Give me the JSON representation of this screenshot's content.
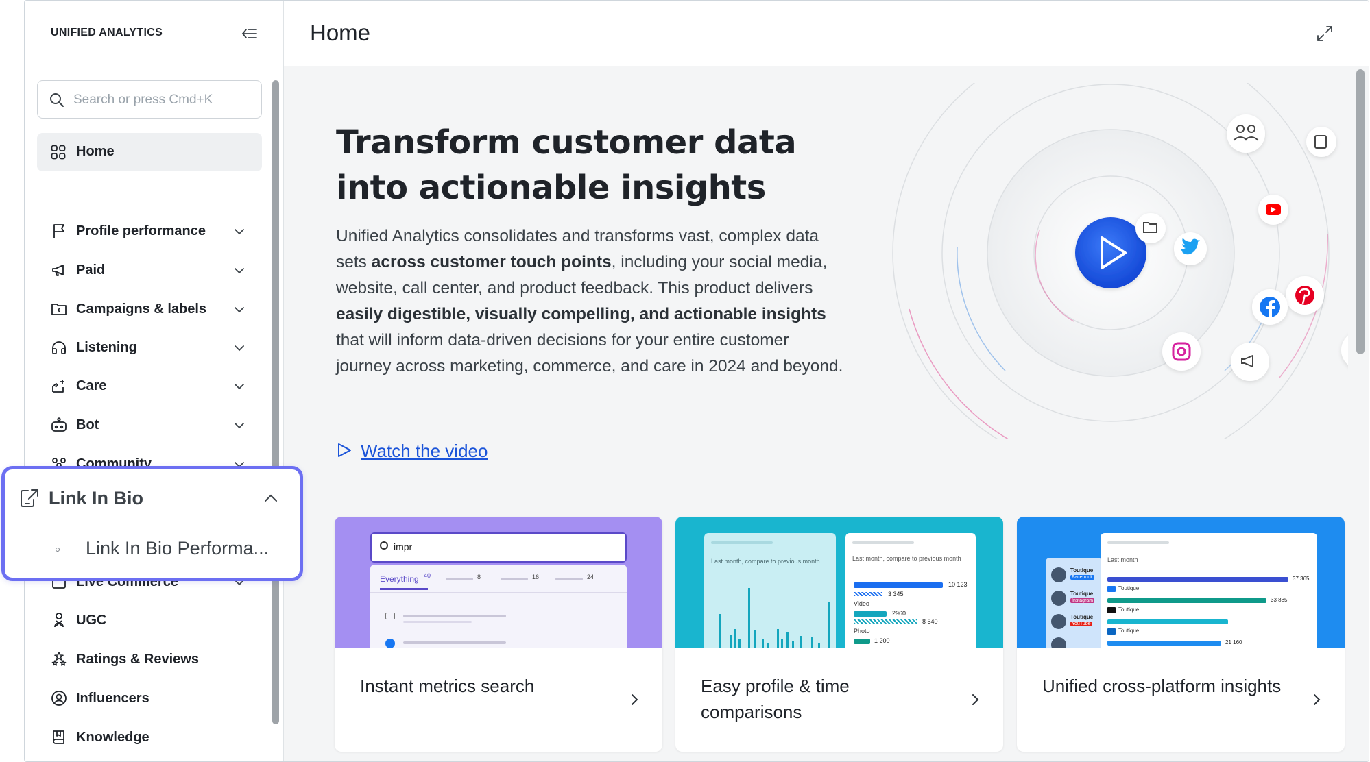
{
  "app": {
    "name": "UNIFIED ANALYTICS"
  },
  "search": {
    "placeholder": "Search or press Cmd+K"
  },
  "home_item": {
    "label": "Home"
  },
  "nav": {
    "items": [
      {
        "label": "Profile performance",
        "icon": "flag-icon"
      },
      {
        "label": "Paid",
        "icon": "megaphone-icon"
      },
      {
        "label": "Campaigns & labels",
        "icon": "folder-icon"
      },
      {
        "label": "Listening",
        "icon": "headphones-icon"
      },
      {
        "label": "Care",
        "icon": "hand-heart-icon"
      },
      {
        "label": "Bot",
        "icon": "bot-icon"
      },
      {
        "label": "Community",
        "icon": "community-icon"
      },
      {
        "label": "Live Commerce",
        "icon": "live-commerce-icon"
      },
      {
        "label": "UGC",
        "icon": "ugc-icon"
      },
      {
        "label": "Ratings & Reviews",
        "icon": "stars-icon"
      },
      {
        "label": "Influencers",
        "icon": "influencer-icon"
      },
      {
        "label": "Knowledge",
        "icon": "book-icon"
      }
    ]
  },
  "popover": {
    "title": "Link In Bio",
    "sub_item": "Link In Bio Performa..."
  },
  "page": {
    "title": "Home"
  },
  "hero": {
    "title": "Transform customer data into actionable insights",
    "desc_1": "Unified Analytics consolidates and transforms vast, complex data sets ",
    "desc_b1": "across customer touch points",
    "desc_2": ", including your social media, website, call center, and product feedback. This product delivers ",
    "desc_b2": "easily digestible, visually compelling, and actionable insights",
    "desc_3": " that will inform data-driven decisions for your entire customer journey across marketing, commerce, and care in 2024 and beyond.",
    "watch_label": "Watch the video"
  },
  "cards": [
    {
      "title": "Instant metrics search",
      "thumb": {
        "query": "impr",
        "tab": "Everything",
        "tab_count": "40",
        "counts": [
          "8",
          "16",
          "24"
        ]
      }
    },
    {
      "title": "Easy profile & time comparisons",
      "thumb": {
        "caption": "Last month, compare to previous month",
        "values": [
          "10 123",
          "3 345",
          "2960",
          "8 540",
          "1 200"
        ],
        "labels": [
          "Video",
          "Photo"
        ]
      }
    },
    {
      "title": "Unified cross-platform insights",
      "thumb": {
        "caption": "Last month",
        "values": [
          "37 365",
          "33 885",
          "21 160"
        ],
        "labels": [
          "Toutique",
          "Toutique",
          "Toutique"
        ],
        "badges": [
          "Facebook",
          "Instagram",
          "YouTube"
        ]
      }
    }
  ],
  "colors": {
    "accent": "#1b54d9",
    "popover_border": "#6c6ff2",
    "card1_bg": "#a08ef0",
    "card2_bg": "#1ab6d0",
    "card3_bg": "#1e8cf0"
  }
}
